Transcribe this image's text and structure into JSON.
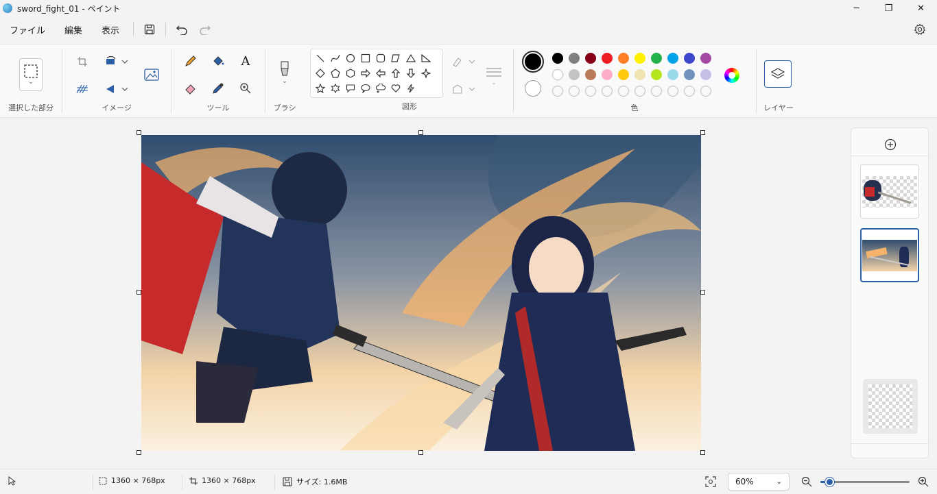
{
  "window": {
    "title": "sword_fight_01 - ペイント",
    "minimize": "─",
    "maximize": "❐",
    "close": "✕"
  },
  "menu": {
    "file": "ファイル",
    "edit": "編集",
    "view": "表示"
  },
  "ribbon": {
    "selection_label": "選択した部分",
    "image_label": "イメージ",
    "tools_label": "ツール",
    "brush_label": "ブラシ",
    "shapes_label": "図形",
    "colors_label": "色",
    "layers_label": "レイヤー",
    "text_tool": "A"
  },
  "colors": {
    "primary": "#000000",
    "secondary": "#ffffff",
    "row1": [
      "#000000",
      "#7f7f7f",
      "#880015",
      "#ed1c24",
      "#ff7f27",
      "#fff200",
      "#22b14c",
      "#00a2e8",
      "#3f48cc",
      "#a349a4"
    ],
    "row2": [
      "#ffffff",
      "#c3c3c3",
      "#b97a57",
      "#ffaec9",
      "#ffc90e",
      "#efe4b0",
      "#b5e61d",
      "#99d9ea",
      "#7092be",
      "#c8bfe7"
    ]
  },
  "status": {
    "selection_size": "1360 × 768px",
    "canvas_size": "1360 × 768px",
    "file_size": "サイズ: 1.6MB",
    "zoom": "60%",
    "zoom_level": 0.1
  }
}
